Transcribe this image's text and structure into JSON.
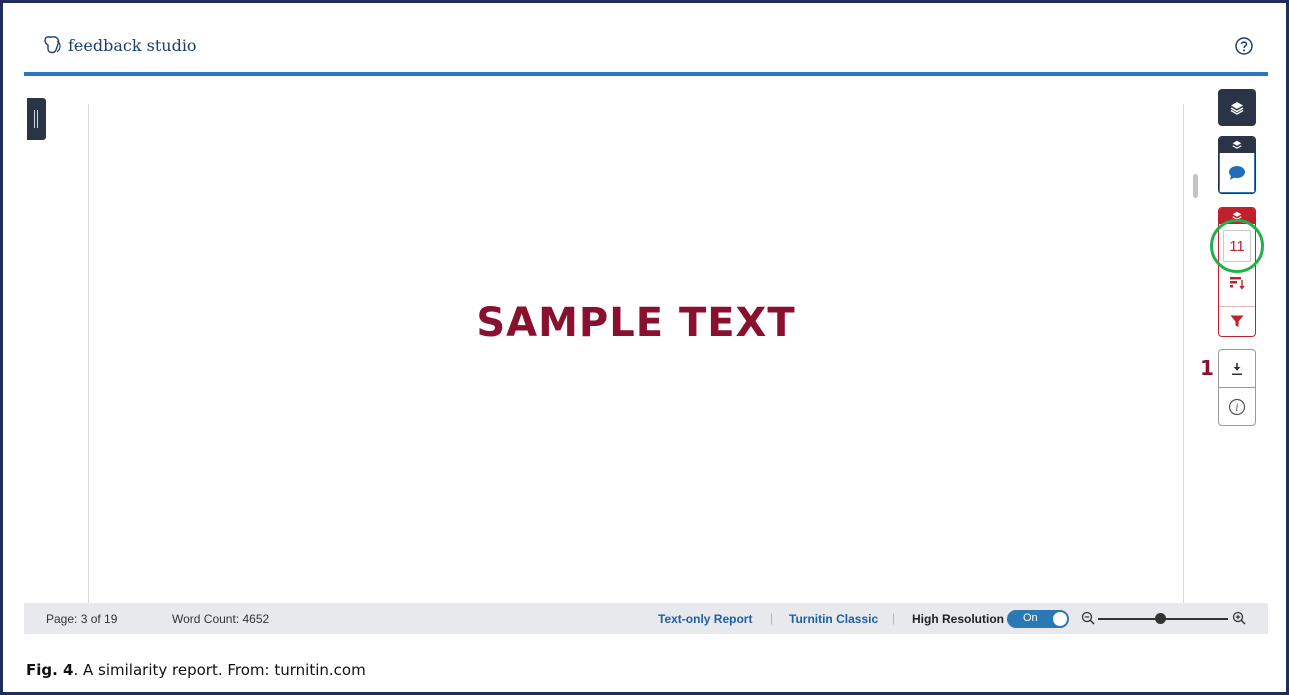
{
  "header": {
    "brand_name": "feedback studio",
    "help_icon": "question-circle-icon"
  },
  "document": {
    "sample_text": "SAMPLE TEXT"
  },
  "toolbar": {
    "layers_icon": "layers-icon",
    "comment_icon": "speech-bubble-icon",
    "match_count": "11",
    "sort_icon": "sort-icon",
    "filter_icon": "filter-icon",
    "download_icon": "download-icon",
    "info_icon": "info-icon",
    "callout_number": "1"
  },
  "statusbar": {
    "page": "Page: 3 of 19",
    "word_count": "Word Count: 4652",
    "text_only_report": "Text-only Report",
    "turnitin_classic": "Turnitin Classic",
    "high_resolution": "High Resolution",
    "toggle_state": "On",
    "separator": "|"
  },
  "caption": {
    "label": "Fig. 4",
    "text": ". A similarity report. From: turnitin.com"
  },
  "colors": {
    "brand_blue": "#2a78b4",
    "dark_navy": "#2b3447",
    "match_red": "#c0202e",
    "sample_text": "#8a1030",
    "highlight_ring": "#22b04a"
  }
}
